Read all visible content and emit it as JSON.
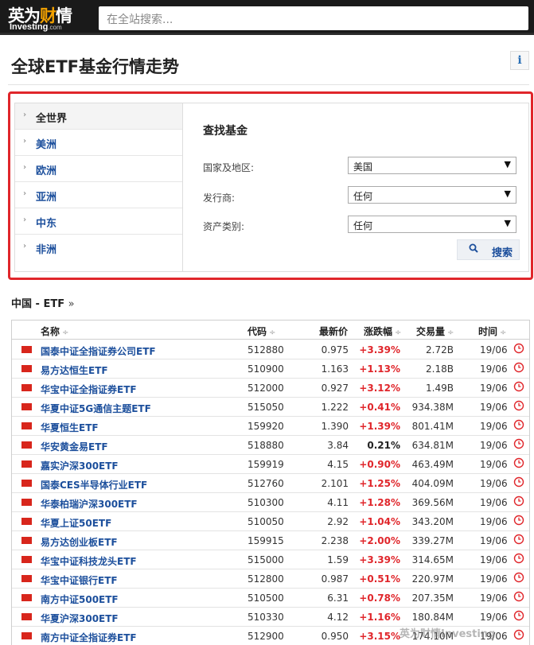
{
  "header": {
    "logo_cn": "英为财情",
    "logo_en": "Investing",
    "logo_en_suffix": ".com",
    "search_placeholder": "在全站搜索..."
  },
  "page": {
    "title": "全球ETF基金行情走势",
    "info_icon_glyph": "i"
  },
  "regions": [
    {
      "label": "全世界",
      "active": true
    },
    {
      "label": "美洲",
      "active": false
    },
    {
      "label": "欧洲",
      "active": false
    },
    {
      "label": "亚洲",
      "active": false
    },
    {
      "label": "中东",
      "active": false
    },
    {
      "label": "非洲",
      "active": false
    }
  ],
  "finder": {
    "title": "查找基金",
    "country_label": "国家及地区:",
    "country_value": "美国",
    "issuer_label": "发行商:",
    "issuer_value": "任何",
    "asset_label": "资产类别:",
    "asset_value": "任何",
    "search_button": "搜索"
  },
  "section": {
    "title": "中国 - ETF",
    "suffix": "»"
  },
  "table": {
    "columns": {
      "name": "名称",
      "code": "代码",
      "last": "最新价",
      "change": "涨跌幅",
      "volume": "交易量",
      "time": "时间"
    },
    "sort_glyph": "÷",
    "rows": [
      {
        "name": "国泰中证全指证券公司ETF",
        "code": "512880",
        "last": "0.975",
        "change": "+3.39%",
        "volume": "2.72B",
        "time": "19/06"
      },
      {
        "name": "易方达恒生ETF",
        "code": "510900",
        "last": "1.163",
        "change": "+1.13%",
        "volume": "2.18B",
        "time": "19/06"
      },
      {
        "name": "华宝中证全指证券ETF",
        "code": "512000",
        "last": "0.927",
        "change": "+3.12%",
        "volume": "1.49B",
        "time": "19/06"
      },
      {
        "name": "华夏中证5G通信主题ETF",
        "code": "515050",
        "last": "1.222",
        "change": "+0.41%",
        "volume": "934.38M",
        "time": "19/06"
      },
      {
        "name": "华夏恒生ETF",
        "code": "159920",
        "last": "1.390",
        "change": "+1.39%",
        "volume": "801.41M",
        "time": "19/06"
      },
      {
        "name": "华安黄金易ETF",
        "code": "518880",
        "last": "3.84",
        "change": "0.21%",
        "volume": "634.81M",
        "time": "19/06"
      },
      {
        "name": "嘉实沪深300ETF",
        "code": "159919",
        "last": "4.15",
        "change": "+0.90%",
        "volume": "463.49M",
        "time": "19/06"
      },
      {
        "name": "国泰CES半导体行业ETF",
        "code": "512760",
        "last": "2.101",
        "change": "+1.25%",
        "volume": "404.09M",
        "time": "19/06"
      },
      {
        "name": "华泰柏瑞沪深300ETF",
        "code": "510300",
        "last": "4.11",
        "change": "+1.28%",
        "volume": "369.56M",
        "time": "19/06"
      },
      {
        "name": "华夏上证50ETF",
        "code": "510050",
        "last": "2.92",
        "change": "+1.04%",
        "volume": "343.20M",
        "time": "19/06"
      },
      {
        "name": "易方达创业板ETF",
        "code": "159915",
        "last": "2.238",
        "change": "+2.00%",
        "volume": "339.27M",
        "time": "19/06"
      },
      {
        "name": "华宝中证科技龙头ETF",
        "code": "515000",
        "last": "1.59",
        "change": "+3.39%",
        "volume": "314.65M",
        "time": "19/06"
      },
      {
        "name": "华宝中证银行ETF",
        "code": "512800",
        "last": "0.987",
        "change": "+0.51%",
        "volume": "220.97M",
        "time": "19/06"
      },
      {
        "name": "南方中证500ETF",
        "code": "510500",
        "last": "6.31",
        "change": "+0.78%",
        "volume": "207.35M",
        "time": "19/06"
      },
      {
        "name": "华夏沪深300ETF",
        "code": "510330",
        "last": "4.12",
        "change": "+1.16%",
        "volume": "180.84M",
        "time": "19/06"
      },
      {
        "name": "南方中证全指证券ETF",
        "code": "512900",
        "last": "0.950",
        "change": "+3.15%",
        "volume": "174.10M",
        "time": "19/06"
      }
    ]
  },
  "watermark": "英为财情Investing",
  "colors": {
    "header_bg": "#1a1a1a",
    "link_blue": "#1c4f9c",
    "positive_red": "#e0262b",
    "highlight_border": "#e0262b",
    "flag_red": "#d8261c"
  }
}
